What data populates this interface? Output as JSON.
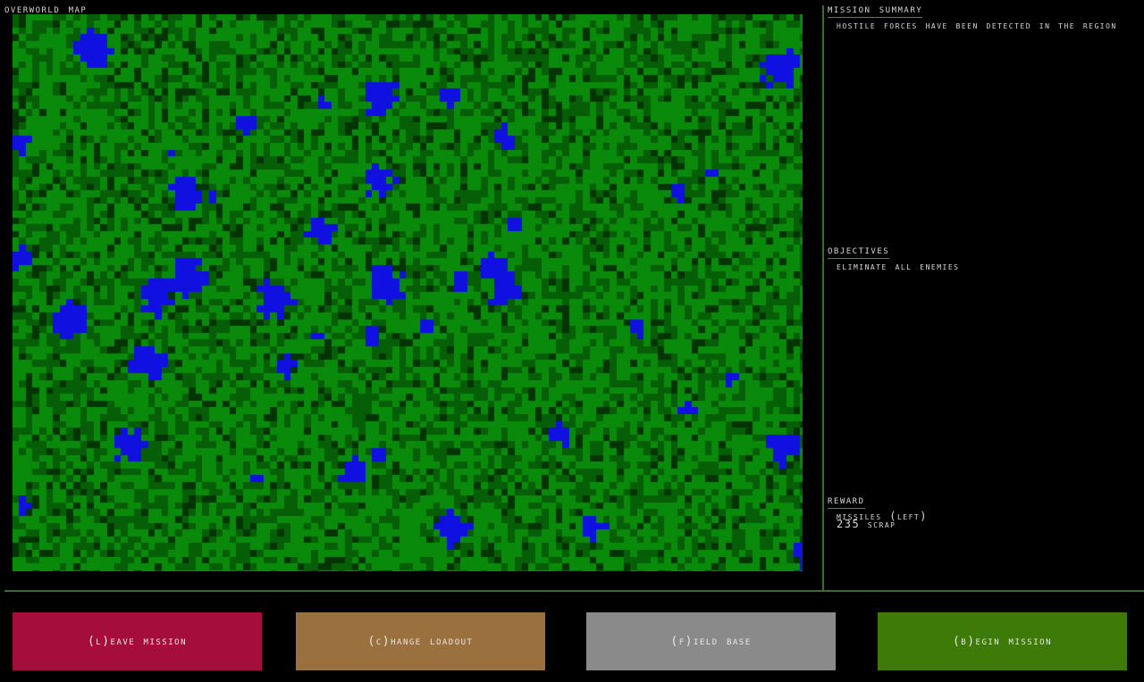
{
  "map": {
    "title": "Overworld map",
    "colors": {
      "grass": "#0a8a0a",
      "grass_dark": "#065f06",
      "grass_shadow": "#033503",
      "water": "#1010e0"
    }
  },
  "mission_summary": {
    "title": "Mission summary",
    "text": "Hostile forces have been detected in the region"
  },
  "objectives": {
    "title": "Objectives",
    "items": [
      "Eliminate all enemies"
    ]
  },
  "reward": {
    "title": "Reward",
    "items": [
      "Missiles (Left)",
      "235 scrap"
    ]
  },
  "buttons": {
    "leave": {
      "label": "(L)eave mission",
      "color": "#a50d3d"
    },
    "loadout": {
      "label": "(C)hange loadout",
      "color": "#9a703e"
    },
    "field_base": {
      "label": "(F)ield base",
      "color": "#8a8a8a"
    },
    "begin": {
      "label": "(B)egin mission",
      "color": "#3e7a08"
    }
  }
}
